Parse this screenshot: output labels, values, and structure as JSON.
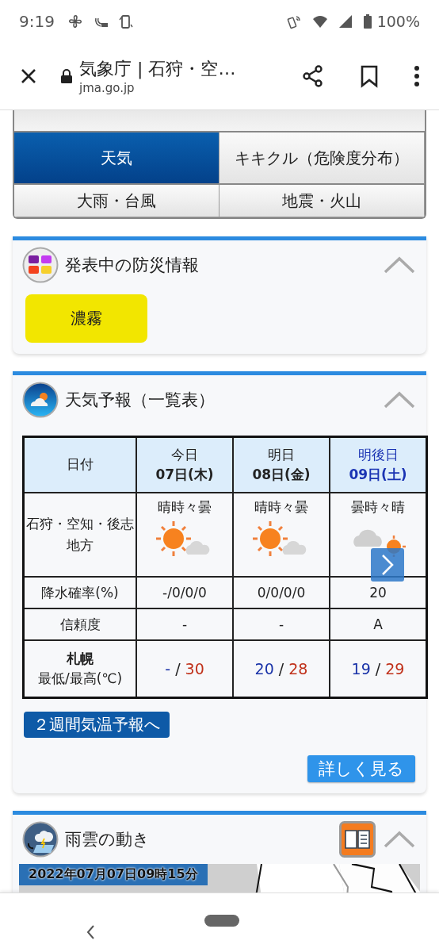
{
  "status_bar": {
    "time": "9:19",
    "battery": "100%"
  },
  "browser": {
    "title": "気象庁 | 石狩・空…",
    "url": "jma.go.jp"
  },
  "nav_tabs": [
    {
      "label": "天気",
      "selected": true
    },
    {
      "label": "キキクル（危険度分布）",
      "selected": false
    },
    {
      "label": "大雨・台風",
      "selected": false
    },
    {
      "label": "地震・火山",
      "selected": false
    }
  ],
  "warnings_card": {
    "title": "発表中の防災情報",
    "expanded": true,
    "warnings": [
      {
        "label": "濃霧",
        "color": "#f2e600"
      }
    ]
  },
  "forecast_card": {
    "title": "天気予報（一覧表）",
    "expanded": true,
    "table": {
      "date_header": "日付",
      "days": [
        {
          "label": "今日",
          "date": "07日(木)",
          "color": "#222222"
        },
        {
          "label": "明日",
          "date": "08日(金)",
          "color": "#222222"
        },
        {
          "label": "明後日",
          "date": "09日(土)",
          "color": "#1a33b3"
        }
      ],
      "area": "石狩・空知・後志地方",
      "weather": [
        {
          "text": "晴時々曇",
          "kind": "sun_cloud"
        },
        {
          "text": "晴時々曇",
          "kind": "sun_cloud"
        },
        {
          "text": "曇時々晴",
          "kind": "cloud_sun"
        }
      ],
      "rain_label": "降水確率(%)",
      "rain": [
        "-/0/0/0",
        "0/0/0/0",
        "20"
      ],
      "reliability_label": "信頼度",
      "reliability": [
        "-",
        "-",
        "A"
      ],
      "city": "札幌",
      "temp_label": "最低/最高(℃)",
      "temps": [
        {
          "min": "-",
          "sep": "/",
          "max": "30"
        },
        {
          "min": "20",
          "sep": "/",
          "max": "28"
        },
        {
          "min": "19",
          "sep": "/",
          "max": "29"
        }
      ]
    },
    "link": "２週間気温予報へ",
    "details_button": "詳しく見る"
  },
  "radar_card": {
    "title": "雨雲の動き",
    "expanded": true,
    "timestamp": "2022年07月07日09時15分"
  }
}
